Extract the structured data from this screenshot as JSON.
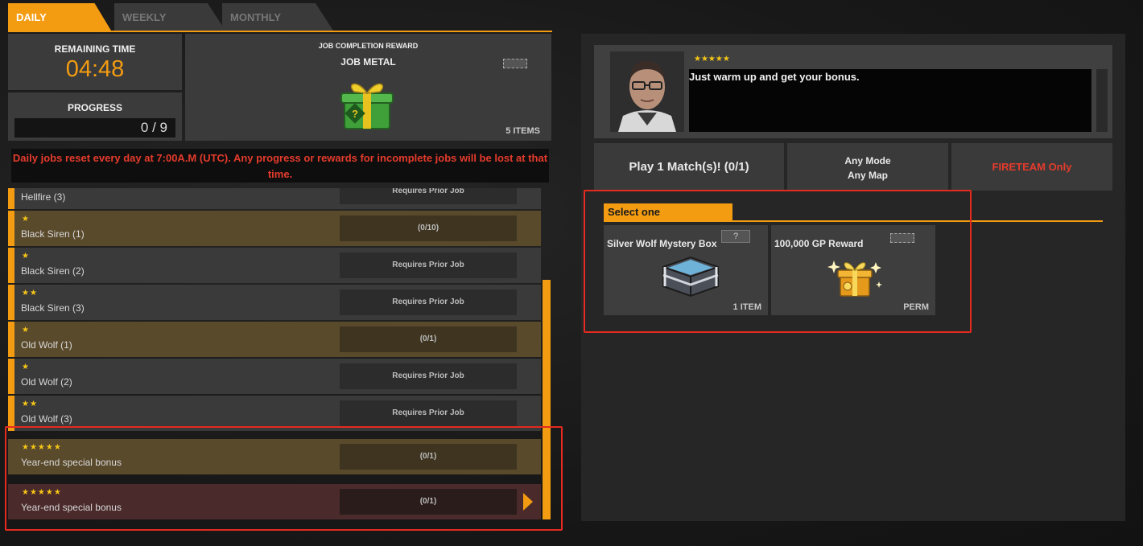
{
  "tabs": [
    {
      "label": "DAILY",
      "active": true
    },
    {
      "label": "WEEKLY",
      "active": false
    },
    {
      "label": "MONTHLY",
      "active": false
    }
  ],
  "remaining_time": {
    "label": "REMAINING TIME",
    "value": "04:48"
  },
  "progress": {
    "label": "PROGRESS",
    "value": "0 / 9"
  },
  "completion_reward": {
    "title": "JOB COMPLETION REWARD",
    "name": "JOB METAL",
    "count": "5 ITEMS",
    "icon": "gift-box-icon"
  },
  "notice": "Daily jobs reset every day at 7:00A.M (UTC). Any progress or rewards for incomplete jobs will be lost at that time.",
  "jobs": [
    {
      "stars": "",
      "name": "Hellfire (3)",
      "status": "Requires Prior Job",
      "style": "normal"
    },
    {
      "stars": "★",
      "name": "Black Siren (1)",
      "status": "(0/10)",
      "style": "gold"
    },
    {
      "stars": "★",
      "name": "Black Siren (2)",
      "status": "Requires Prior Job",
      "style": "normal"
    },
    {
      "stars": "★★",
      "name": "Black Siren (3)",
      "status": "Requires Prior Job",
      "style": "normal"
    },
    {
      "stars": "★",
      "name": "Old Wolf (1)",
      "status": "(0/1)",
      "style": "gold"
    },
    {
      "stars": "★",
      "name": "Old Wolf (2)",
      "status": "Requires Prior Job",
      "style": "normal"
    },
    {
      "stars": "★★",
      "name": "Old Wolf (3)",
      "status": "Requires Prior Job",
      "style": "normal"
    },
    {
      "stars": "★★★★★",
      "name": "Year-end special bonus",
      "status": "(0/1)",
      "style": "gold"
    },
    {
      "stars": "★★★★★",
      "name": "Year-end special bonus",
      "status": "(0/1)",
      "style": "red"
    }
  ],
  "npc": {
    "stars": "★★★★★",
    "dialog": "Just warm up and get your bonus.",
    "portrait": "npc-portrait-icon"
  },
  "conditions": {
    "objective": "Play 1 Match(s)! (0/1)",
    "mode": "Any Mode",
    "map": "Any Map",
    "restriction": "FIRETEAM Only"
  },
  "select": {
    "header": "Select one",
    "options": [
      {
        "name": "Silver Wolf Mystery Box",
        "footer": "1 ITEM",
        "icon": "mystery-box-icon",
        "badge": "?"
      },
      {
        "name": "100,000 GP Reward",
        "footer": "PERM",
        "icon": "gold-gift-icon"
      }
    ]
  },
  "colors": {
    "accent": "#f39c12",
    "alert": "#e53b2c",
    "highlight": "#e52a1f",
    "star": "#f5c518"
  }
}
